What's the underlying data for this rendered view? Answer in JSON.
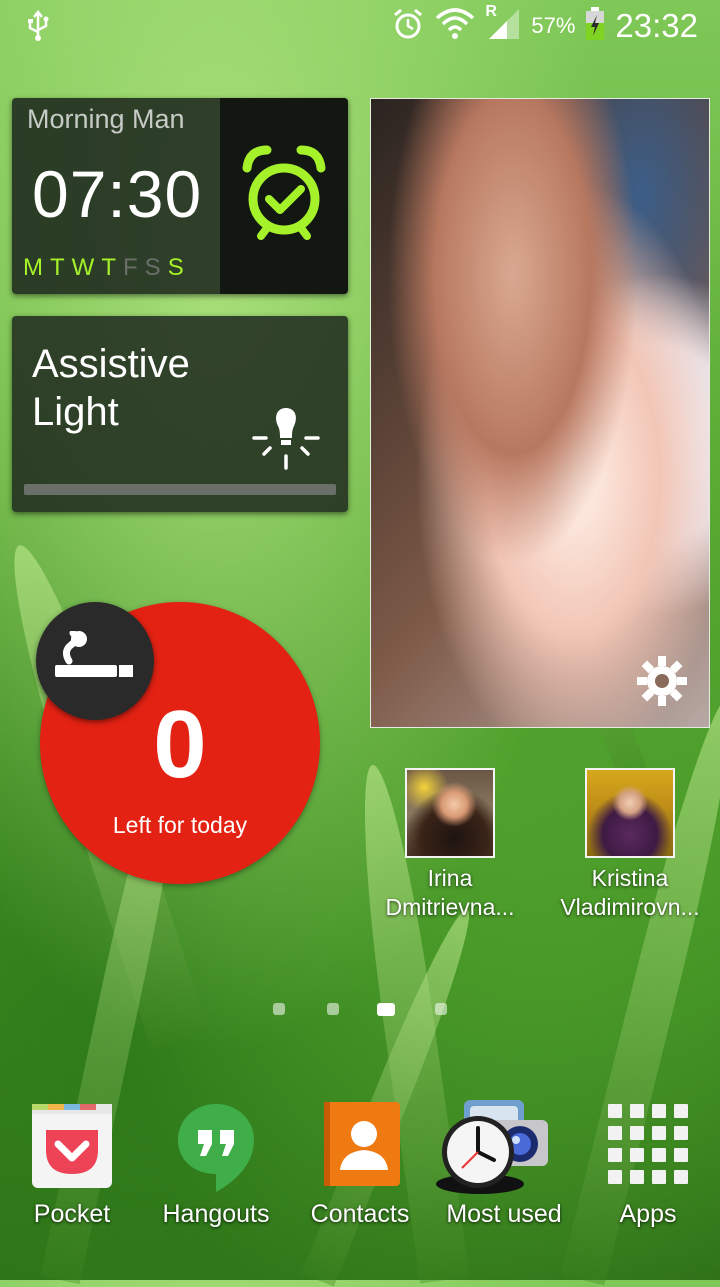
{
  "status_bar": {
    "usb_icon": "usb-icon",
    "alarm_icon": "alarm-icon",
    "wifi_icon": "wifi-icon",
    "roaming_indicator": "R",
    "signal_icon": "signal-icon",
    "battery_percent": "57%",
    "battery_icon": "battery-charging-icon",
    "time": "23:32"
  },
  "alarm_widget": {
    "name": "Morning Man",
    "time": "07:30",
    "days": [
      {
        "label": "M",
        "active": true
      },
      {
        "label": "T",
        "active": true
      },
      {
        "label": "W",
        "active": true
      },
      {
        "label": "T",
        "active": true
      },
      {
        "label": "F",
        "active": false
      },
      {
        "label": "S",
        "active": false
      },
      {
        "label": "S",
        "active": true
      }
    ],
    "icon": "alarm-clock-icon",
    "accent_color": "#a6f22a"
  },
  "assistive_light": {
    "title": "Assistive Light",
    "icon": "light-bulb-icon"
  },
  "photo_widget": {
    "settings_icon": "gear-icon"
  },
  "smoking_widget": {
    "count": "0",
    "label": "Left for today",
    "icon": "cigarette-icon",
    "color": "#e32213"
  },
  "contacts": [
    {
      "name": "Irina Dmitrievna..."
    },
    {
      "name": "Kristina Vladimirovn..."
    }
  ],
  "page_indicator": {
    "total": 4,
    "active": 3
  },
  "dock": [
    {
      "label": "Pocket",
      "icon": "pocket-icon"
    },
    {
      "label": "Hangouts",
      "icon": "hangouts-icon"
    },
    {
      "label": "Contacts",
      "icon": "contacts-icon"
    },
    {
      "label": "Most used",
      "icon": "most-used-icon"
    },
    {
      "label": "Apps",
      "icon": "apps-grid-icon"
    }
  ]
}
